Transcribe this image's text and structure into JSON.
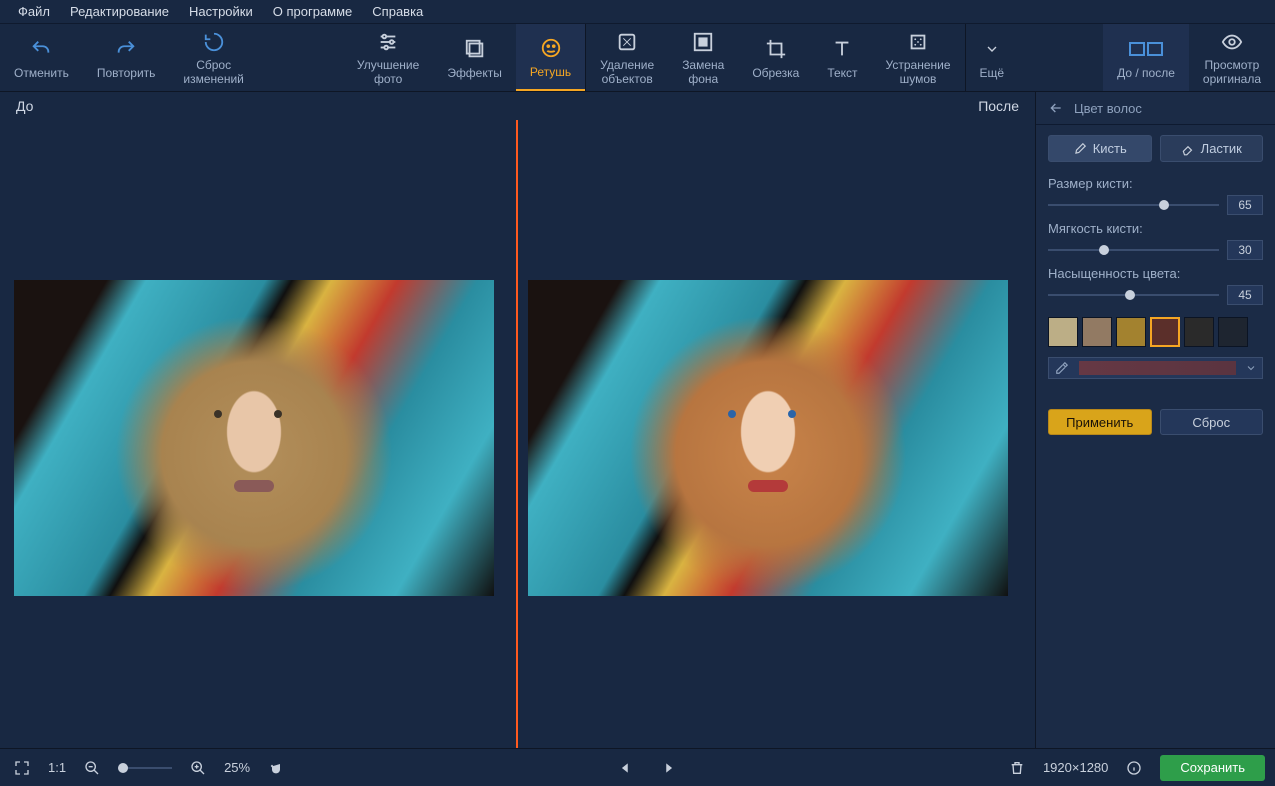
{
  "menu": {
    "items": [
      "Файл",
      "Редактирование",
      "Настройки",
      "О программе",
      "Справка"
    ]
  },
  "toolbar": {
    "undo": "Отменить",
    "redo": "Повторить",
    "reset": "Сброс\nизменений",
    "enhance": "Улучшение\nфото",
    "effects": "Эффекты",
    "retouch": "Ретушь",
    "remove_obj": "Удаление\nобъектов",
    "replace_bg": "Замена\nфона",
    "crop": "Обрезка",
    "text": "Текст",
    "denoise": "Устранение\nшумов",
    "more": "Ещё",
    "before_after": "До / после",
    "view_original": "Просмотр\nоригинала"
  },
  "canvas": {
    "before_label": "До",
    "after_label": "После"
  },
  "panel": {
    "title": "Цвет волос",
    "brush": "Кисть",
    "eraser": "Ластик",
    "size_label": "Размер кисти:",
    "size_value": "65",
    "soft_label": "Мягкость кисти:",
    "soft_value": "30",
    "sat_label": "Насыщенность цвета:",
    "sat_value": "45",
    "swatches": [
      "#bcae86",
      "#927a63",
      "#a3822f",
      "#5b2f2a",
      "#2a2a2a",
      "#1e2530"
    ],
    "selected_swatch": 3,
    "apply": "Применить",
    "reset": "Сброс"
  },
  "bottom": {
    "fit": "1:1",
    "zoom_pct": "25%",
    "dims": "1920×1280",
    "save": "Сохранить"
  }
}
